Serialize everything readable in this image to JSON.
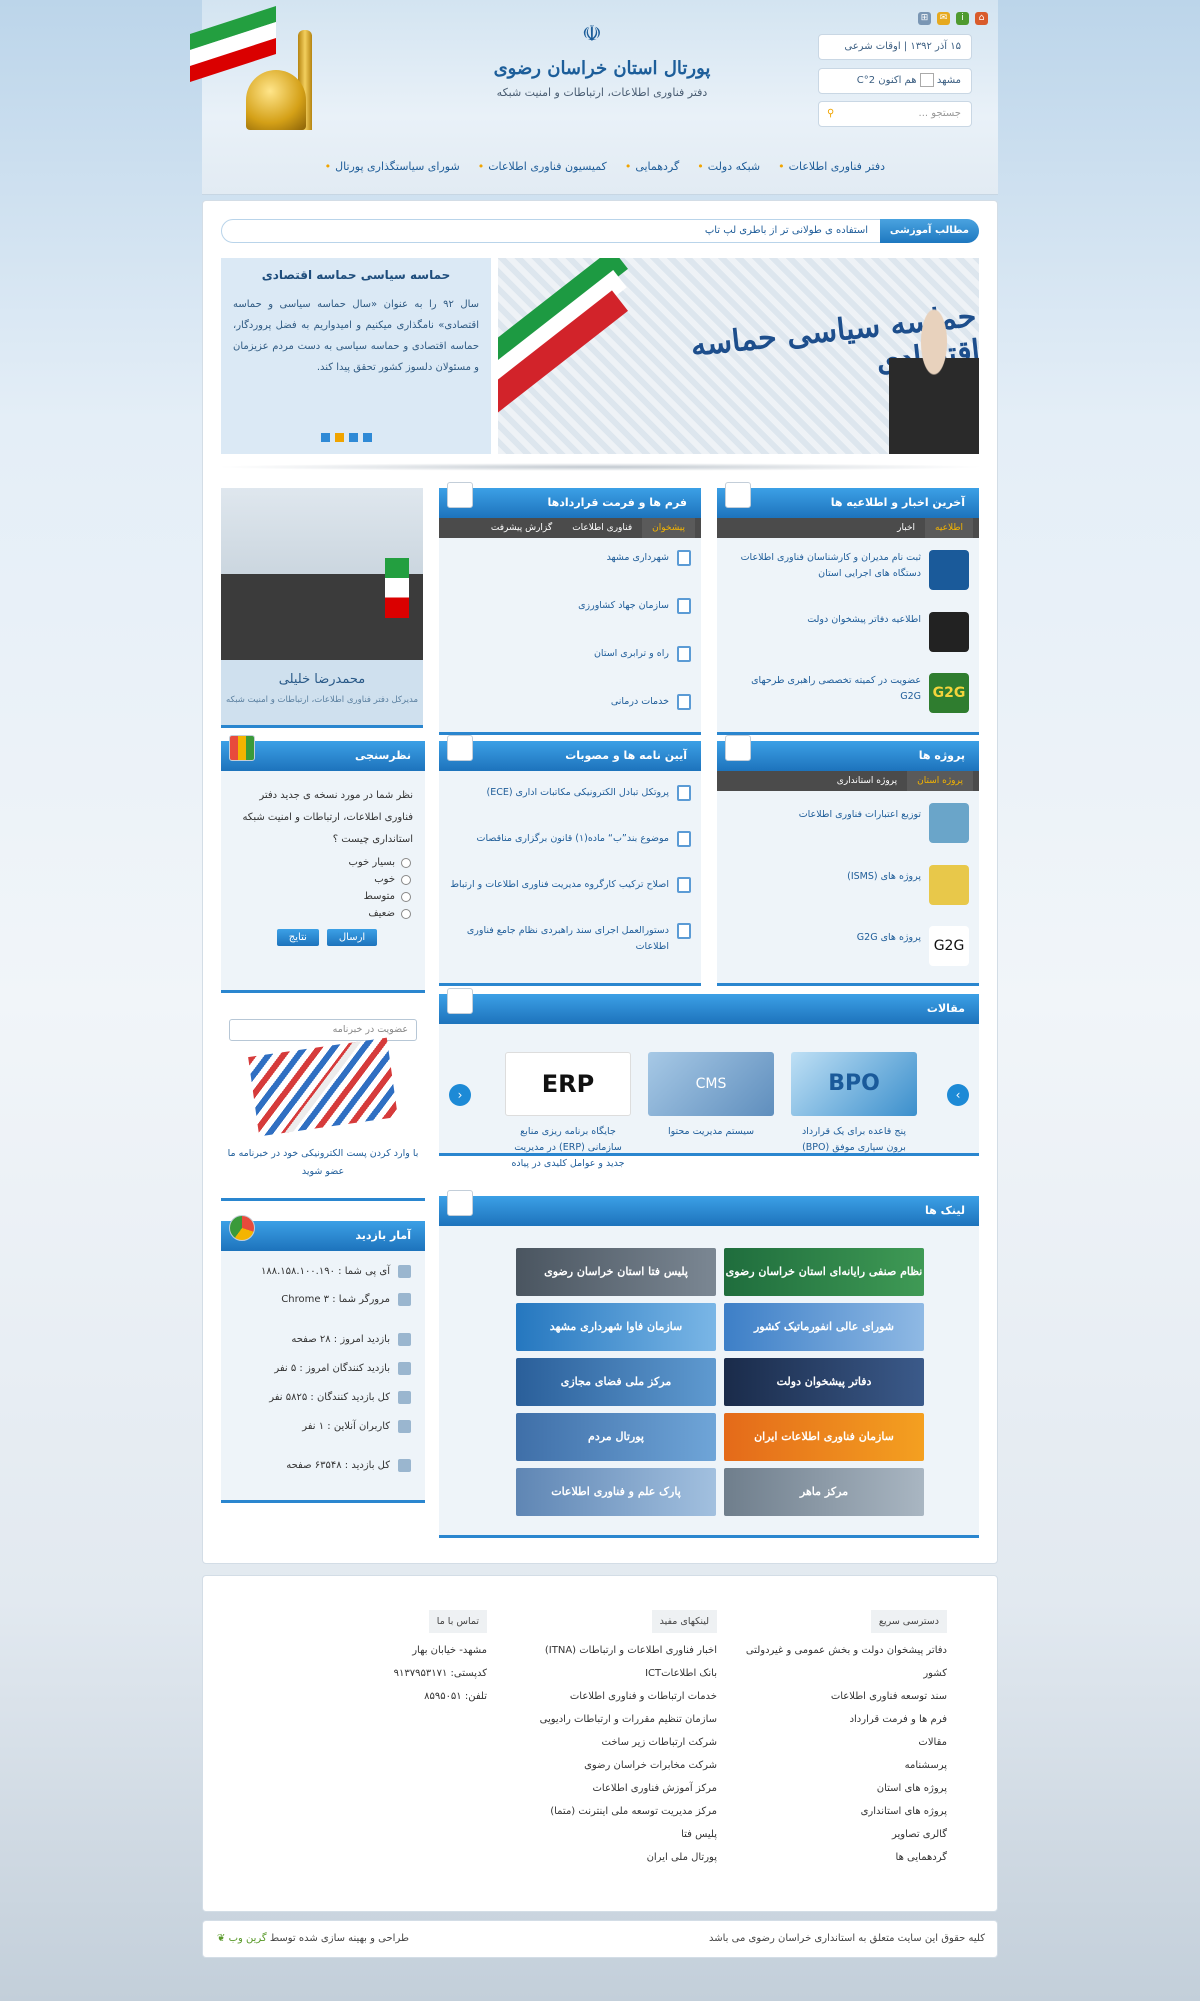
{
  "top": {
    "date": "۱۵ آذر ۱۳۹۲",
    "sharia_link": "اوقات شرعی",
    "city": "مشهد",
    "weather": "هم اکنون C°2",
    "search_placeholder": "جستجو ..."
  },
  "logo": {
    "title": "پورتال استان خراسان رضوی",
    "subtitle": "دفتر فناوری اطلاعات، ارتباطات و امنیت شبکه"
  },
  "nav": [
    "دفتر فناوری اطلاعات",
    "شبکه دولت",
    "گردهمایی",
    "کمیسیون فناوری اطلاعات",
    "شورای سیاستگذاری پورتال"
  ],
  "ticker": {
    "label": "مطالب آموزشی",
    "text": "استفاده ی طولانی تر از باطری لپ تاپ"
  },
  "slider": {
    "heading": "حماسه سیاسی حماسه اقتصادی",
    "body": "سال ۹۲ را به عنوان «سال حماسه سیاسی و حماسه اقتصادی» نامگذاری میکنیم و امیدواریم به فضل پروردگار، حماسه اقتصادی و حماسه سیاسی به دست مردم عزیزمان و مسئولان دلسوز کشور تحقق پیدا کند.",
    "calligraphy": "حماسه سیاسی حماسه اقتصادی"
  },
  "news": {
    "title": "آخرین اخبار و اطلاعیه ها",
    "tabs": [
      "اطلاعیه",
      "اخبار"
    ],
    "items": [
      "ثبت نام مدیران و کارشناسان فناوری اطلاعات دستگاه های اجرایی استان",
      "اطلاعیه دفاتر پیشخوان دولت",
      "عضویت در کمیته تخصصی راهبری طرحهای G2G"
    ]
  },
  "forms": {
    "title": "فرم ها و فرمت قراردادها",
    "tabs": [
      "پیشخوان",
      "فناوری اطلاعات",
      "گزارش پیشرفت"
    ],
    "items": [
      "شهرداری مشهد",
      "سازمان جهاد کشاورزی",
      "راه و ترابری استان",
      "خدمات درمانی"
    ]
  },
  "director": {
    "name": "محمدرضا خلیلی",
    "role": "مدیرکل دفتر فناوری اطلاعات، ارتباطات و امنیت شبکه"
  },
  "projects": {
    "title": "پروژه ها",
    "tabs": [
      "پروژه استان",
      "پروژه استانداری"
    ],
    "items": [
      "توزیع اعتبارات فناوری اطلاعات",
      "پروژه های (ISMS)",
      "پروژه های G2G"
    ]
  },
  "regulations": {
    "title": "آیین نامه ها و مصوبات",
    "items": [
      "پروتکل تبادل الکترونیکی مکاتبات اداری (ECE)",
      "موضوع بند”ب“ ماده(۱) قانون برگزاری مناقصات",
      "اصلاح ترکیب کارگروه مدیریت فناوری اطلاعات و ارتباط",
      "دستورالعمل اجرای سند راهبردی نظام جامع فناوری اطلاعات"
    ]
  },
  "poll": {
    "title": "نظرسنجی",
    "question": "نظر شما در مورد نسخه ی جدید دفتر فناوری اطلاعات، ارتباطات و امنیت شبکه استانداری چیست ؟",
    "options": [
      "بسیار خوب",
      "خوب",
      "متوسط",
      "ضعیف"
    ],
    "submit": "ارسال",
    "results": "نتایج"
  },
  "newsletter": {
    "placeholder": "عضویت در خبرنامه",
    "text": "با وارد کردن پست الکترونیکی خود در خبرنامه ما عضو شوید"
  },
  "stats": {
    "title": "آمار بازدید",
    "rows": [
      "آی پی شما : ۱۸۸.۱۵۸.۱۰۰.۱۹۰",
      "مرورگر شما : Chrome ۳",
      "بازدید امروز : ۲۸ صفحه",
      "بازدید کنندگان امروز : ۵ نفر",
      "کل بازدید کنندگان : ۵۸۲۵ نفر",
      "کاربران آنلاین : ۱ نفر",
      "کل بازدید : ۶۳۵۴۸ صفحه"
    ]
  },
  "articles": {
    "title": "مقالات",
    "items": [
      "پنج قاعده برای یک قرارداد برون سپاری موفق (BPO)",
      "سیستم مدیریت محتوا",
      "جایگاه برنامه ریزی منابع سازمانی (ERP) در مدیریت جدید و عوامل کلیدی در پیاده"
    ],
    "pic_labels": [
      "BPO",
      "CMS",
      "ERP"
    ]
  },
  "links": {
    "title": "لینک ها",
    "items": [
      "نظام صنفی رایانه‌ای استان خراسان رضوی",
      "پلیس فتا استان خراسان رضوی",
      "شورای عالی انفورماتیک کشور",
      "سازمان فاوا شهرداری مشهد",
      "دفاتر پیشخوان دولت",
      "مرکز ملی فضای مجازی",
      "سازمان فناوری اطلاعات ایران",
      "پورتال مردم",
      "مرکز ماهر",
      "پارک علم و فناوری اطلاعات"
    ]
  },
  "footer": {
    "quick": {
      "title": "دسترسی سریع",
      "items": [
        "دفاتر پیشخوان دولت و بخش عمومی و غیردولتی کشور",
        "سند توسعه فناوری اطلاعات",
        "فرم ها و فرمت قرارداد",
        "مقالات",
        "پرسشنامه",
        "پروژه های استان",
        "پروژه های استانداری",
        "گالری تصاویر",
        "گردهمایی ها"
      ]
    },
    "useful": {
      "title": "لینکهای مفید",
      "items": [
        "اخبار فناوری اطلاعات و ارتباطات (ITNA)",
        "بانک اطلاعاتICT",
        "خدمات ارتباطات و فناوری اطلاعات",
        "سازمان تنظیم مقررات و ارتباطات رادیویی",
        "شرکت ارتباطات زیر ساخت",
        "شرکت مخابرات خراسان رضوی",
        "مرکز آموزش فناوری اطلاعات",
        "مرکز مدیریت توسعه ملی اینترنت (متما)",
        "پلیس فتا",
        "پورتال ملی ایران"
      ]
    },
    "contact": {
      "title": "تماس با ما",
      "items": [
        "مشهد- خیابان بهار",
        "کدپستی: ۹۱۳۷۹۵۳۱۷۱",
        "تلفن: ۸۵۹۵۰۵۱"
      ]
    }
  },
  "copyright": {
    "text": "کلیه حقوق این سایت متعلق به استانداری خراسان رضوی می باشد",
    "credit": "طراحی و بهینه سازی شده توسط",
    "credit_brand": "گرین وب"
  },
  "colors": {
    "accent": "#1d73bc",
    "highlight": "#f0a400"
  }
}
